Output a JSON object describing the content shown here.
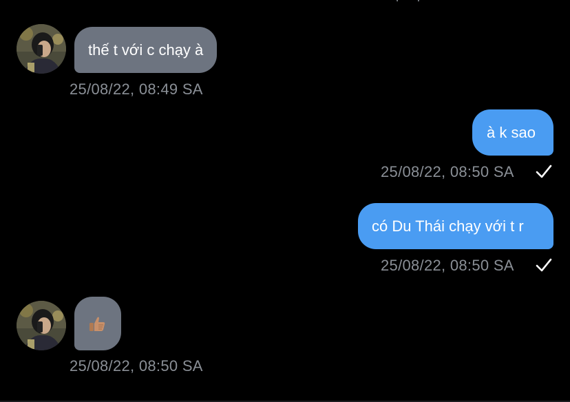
{
  "conversation": {
    "messages": [
      {
        "direction": "in",
        "text": "thế t với c chạy à",
        "timestamp": "25/08/22, 08:49 SA"
      },
      {
        "direction": "out",
        "text": "à k sao",
        "timestamp": "25/08/22, 08:50 SA",
        "status": "sent-check-icon"
      },
      {
        "direction": "out",
        "text": "có Du Thái chạy với t r",
        "timestamp": "25/08/22, 08:50 SA",
        "status": "sent-check-icon"
      },
      {
        "direction": "in",
        "text": "",
        "emoji": "thumbs-up-medium-light",
        "timestamp": "25/08/22, 08:50 SA"
      }
    ]
  },
  "colors": {
    "background": "#000000",
    "incoming_bubble": "#6d7480",
    "outgoing_bubble": "#4a9cf2",
    "timestamp_text": "#8a8f96",
    "check": "#ffffff"
  }
}
